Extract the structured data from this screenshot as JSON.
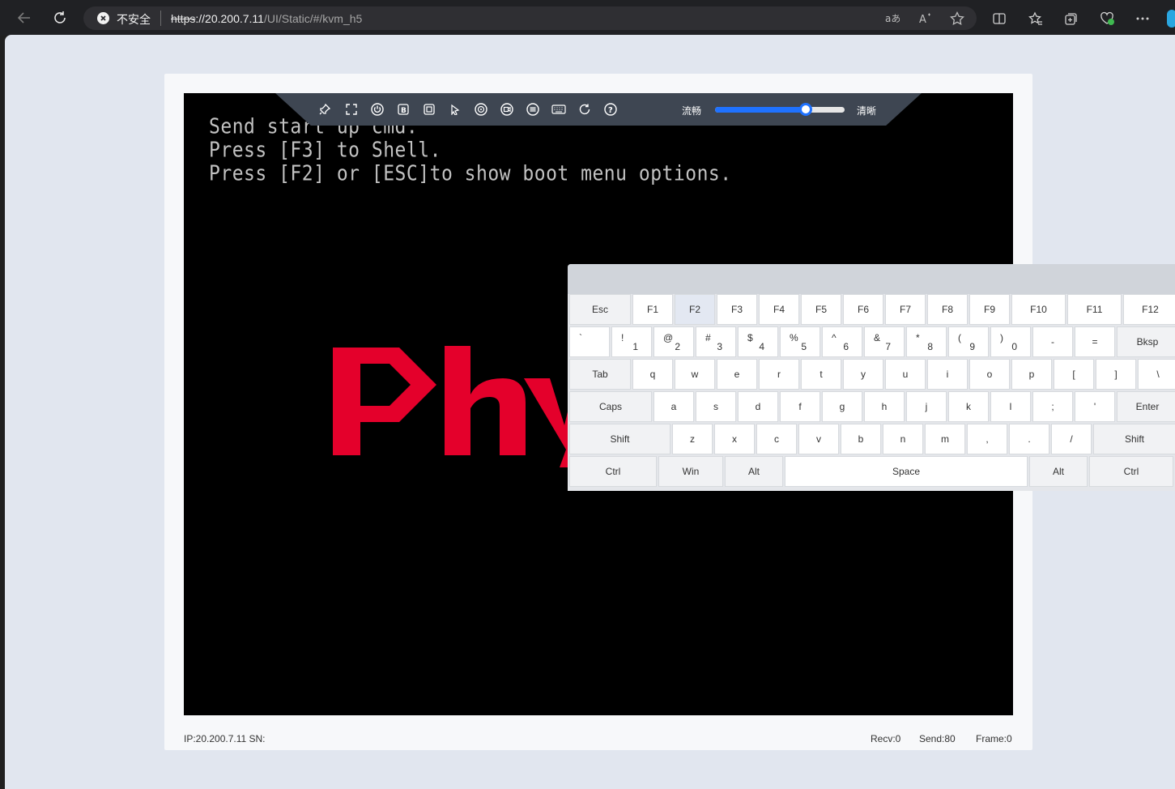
{
  "browser": {
    "security_text": "不安全",
    "url_proto": "https",
    "url_host": "://20.200.7.11",
    "url_path": "/UI/Static/#/kvm_h5"
  },
  "console": {
    "lines": [
      "Send start up cmd.",
      "Press [F3] to Shell.",
      "Press [F2] or [ESC]to show boot menu options."
    ],
    "logo_text": "Phy",
    "logo_color": "#e4002b"
  },
  "toolbar": {
    "tools": [
      "pin-icon",
      "fullscreen-icon",
      "power-icon",
      "boot-icon",
      "screenshot-icon",
      "mouse-icon",
      "virtual-media-icon",
      "record-icon",
      "menu-icon",
      "keyboard-icon",
      "refresh-icon",
      "help-icon"
    ],
    "smooth_label": "流畅",
    "clear_label": "清晰",
    "quality_value": 0.7
  },
  "status": {
    "ip_sn": "IP:20.200.7.11 SN:",
    "recv": "Recv:0",
    "send": "Send:80",
    "frame": "Frame:0"
  },
  "keyboard": {
    "rows": [
      [
        {
          "l": "Esc",
          "mod": true
        },
        {
          "l": "F1"
        },
        {
          "l": "F2",
          "active": true
        },
        {
          "l": "F3"
        },
        {
          "l": "F4"
        },
        {
          "l": "F5"
        },
        {
          "l": "F6"
        },
        {
          "l": "F7"
        },
        {
          "l": "F8"
        },
        {
          "l": "F9"
        },
        {
          "l": "F10"
        },
        {
          "l": "F11"
        },
        {
          "l": "F12"
        }
      ],
      [
        {
          "u": "`",
          "d": ""
        },
        {
          "u": "!",
          "d": "1"
        },
        {
          "u": "@",
          "d": "2"
        },
        {
          "u": "#",
          "d": "3"
        },
        {
          "u": "$",
          "d": "4"
        },
        {
          "u": "%",
          "d": "5"
        },
        {
          "u": "^",
          "d": "6"
        },
        {
          "u": "&",
          "d": "7"
        },
        {
          "u": "*",
          "d": "8"
        },
        {
          "u": "(",
          "d": "9"
        },
        {
          "u": ")",
          "d": "0"
        },
        {
          "l": "-"
        },
        {
          "l": "="
        },
        {
          "l": "Bksp",
          "mod": true
        }
      ],
      [
        {
          "l": "Tab",
          "mod": true
        },
        {
          "l": "q"
        },
        {
          "l": "w"
        },
        {
          "l": "e"
        },
        {
          "l": "r"
        },
        {
          "l": "t"
        },
        {
          "l": "y"
        },
        {
          "l": "u"
        },
        {
          "l": "i"
        },
        {
          "l": "o"
        },
        {
          "l": "p"
        },
        {
          "l": "["
        },
        {
          "l": "]"
        },
        {
          "l": "\\"
        }
      ],
      [
        {
          "l": "Caps",
          "mod": true
        },
        {
          "l": "a"
        },
        {
          "l": "s"
        },
        {
          "l": "d"
        },
        {
          "l": "f"
        },
        {
          "l": "g"
        },
        {
          "l": "h"
        },
        {
          "l": "j"
        },
        {
          "l": "k"
        },
        {
          "l": "l"
        },
        {
          "l": ";"
        },
        {
          "l": "'"
        },
        {
          "l": "Enter",
          "mod": true
        }
      ],
      [
        {
          "l": "Shift",
          "mod": true
        },
        {
          "l": "z"
        },
        {
          "l": "x"
        },
        {
          "l": "c"
        },
        {
          "l": "v"
        },
        {
          "l": "b"
        },
        {
          "l": "n"
        },
        {
          "l": "m"
        },
        {
          "l": ","
        },
        {
          "l": "."
        },
        {
          "l": "/"
        },
        {
          "l": "Shift",
          "mod": true
        }
      ],
      [
        {
          "l": "Ctrl",
          "mod": true
        },
        {
          "l": "Win",
          "mod": true
        },
        {
          "l": "Alt",
          "mod": true
        },
        {
          "l": "Space"
        },
        {
          "l": "Alt",
          "mod": true
        },
        {
          "l": "Ctrl",
          "mod": true
        }
      ]
    ]
  }
}
